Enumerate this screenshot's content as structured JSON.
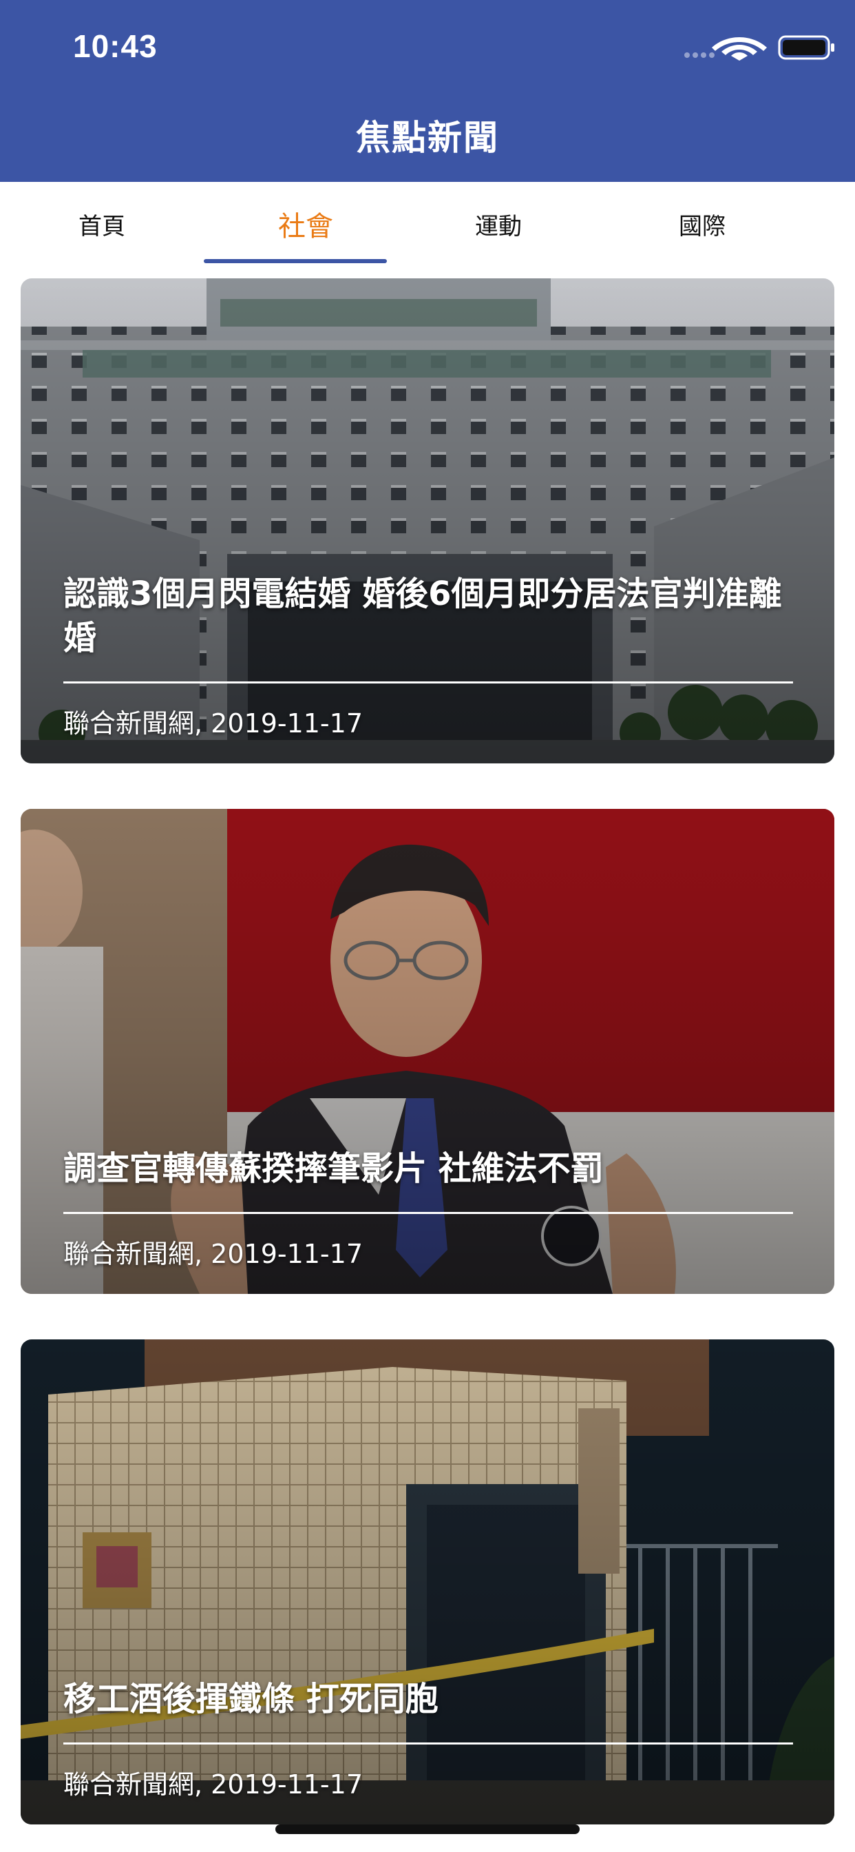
{
  "status": {
    "time": "10:43"
  },
  "header": {
    "title": "焦點新聞",
    "background": "#3c55a5"
  },
  "tabs": [
    {
      "label": "首頁",
      "active": false
    },
    {
      "label": "社會",
      "active": true
    },
    {
      "label": "運動",
      "active": false
    },
    {
      "label": "國際",
      "active": false
    }
  ],
  "colors": {
    "accent": "#ea7b15",
    "indicator": "#3c55a5"
  },
  "articles": [
    {
      "title": "認識3個月閃電結婚 婚後6個月即分居法官判准離婚",
      "source": "聯合新聞網, 2019-11-17",
      "image": "courthouse-building-photo"
    },
    {
      "title": "調查官轉傳蘇揆摔筆影片 社維法不罰",
      "source": "聯合新聞網, 2019-11-17",
      "image": "official-unveiling-photo"
    },
    {
      "title": "移工酒後揮鐵條 打死同胞",
      "source": "聯合新聞網, 2019-11-17",
      "image": "crime-scene-wall-photo"
    }
  ]
}
